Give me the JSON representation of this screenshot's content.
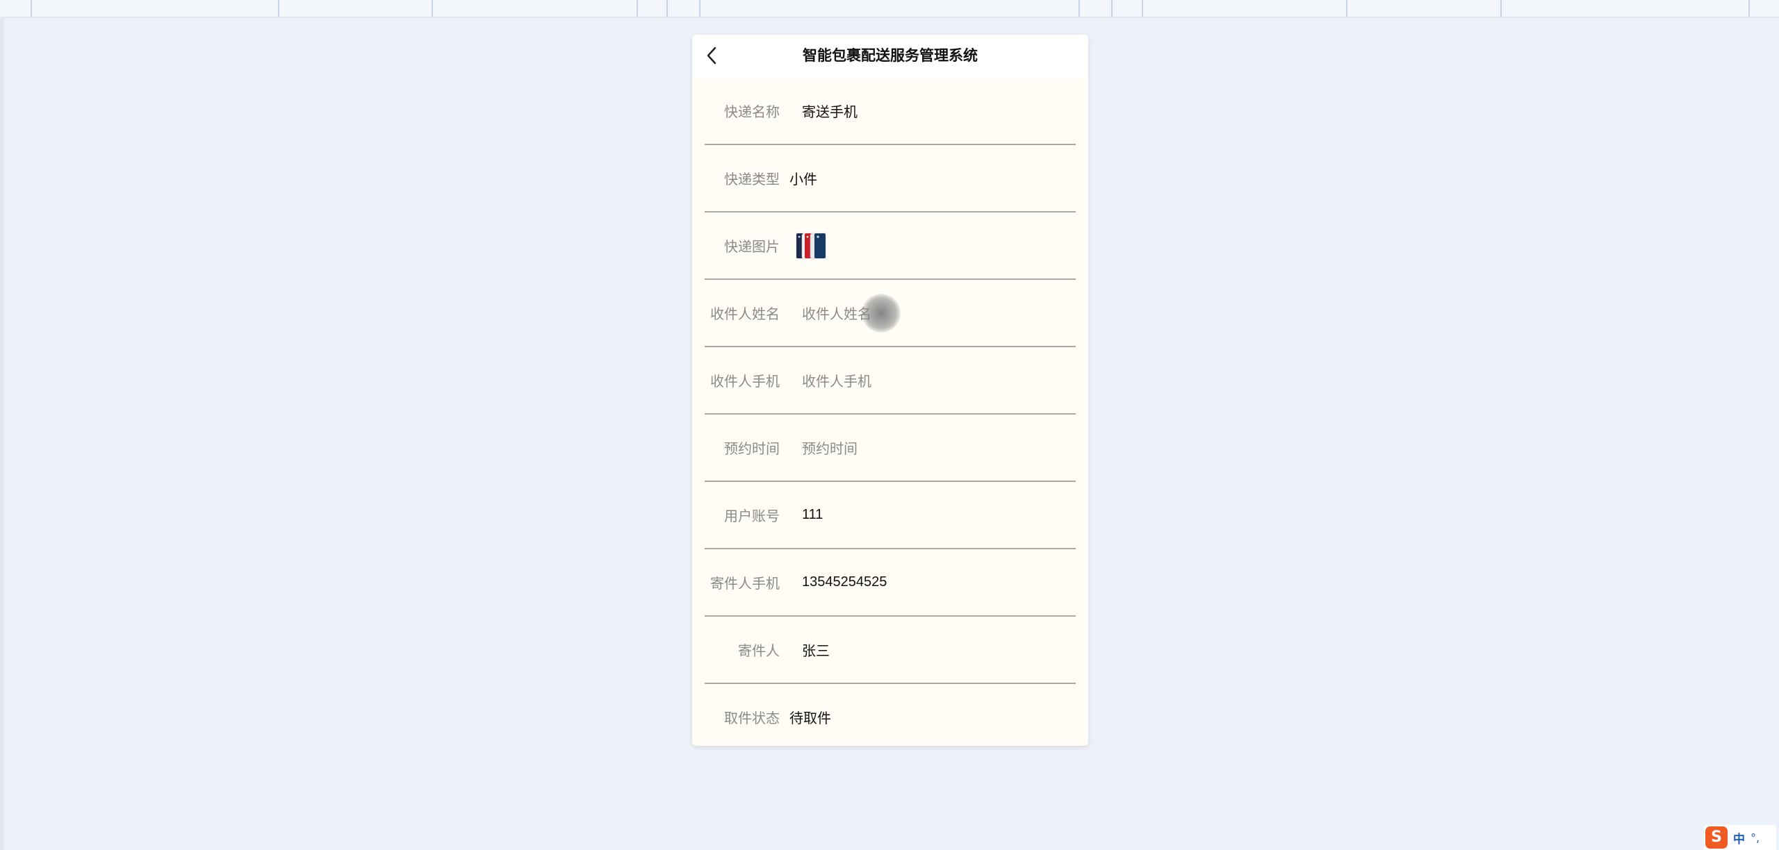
{
  "app": {
    "title": "智能包裹配送服务管理系统"
  },
  "form": {
    "fields": [
      {
        "label": "快递名称",
        "value": "寄送手机",
        "placeholder": ""
      },
      {
        "label": "快递类型",
        "value": "小件",
        "placeholder": ""
      },
      {
        "label": "快递图片",
        "value": "",
        "placeholder": ""
      },
      {
        "label": "收件人姓名",
        "value": "",
        "placeholder": "收件人姓名"
      },
      {
        "label": "收件人手机",
        "value": "",
        "placeholder": "收件人手机"
      },
      {
        "label": "预约时间",
        "value": "",
        "placeholder": "预约时间"
      },
      {
        "label": "用户账号",
        "value": "111",
        "placeholder": ""
      },
      {
        "label": "寄件人手机",
        "value": "13545254525",
        "placeholder": ""
      },
      {
        "label": "寄件人",
        "value": "张三",
        "placeholder": ""
      },
      {
        "label": "取件状态",
        "value": "待取件",
        "placeholder": ""
      }
    ]
  },
  "ime": {
    "logo": "S",
    "lang": "中",
    "punct": "°,"
  },
  "colors": {
    "page_bg": "#edf1f8",
    "card_bg": "#fffdf5",
    "ime_brand": "#ef5b22",
    "ime_text": "#1e5fb4"
  },
  "icons": [
    "back-chevron-icon",
    "phone-image-icon",
    "sogou-ime-icon"
  ]
}
